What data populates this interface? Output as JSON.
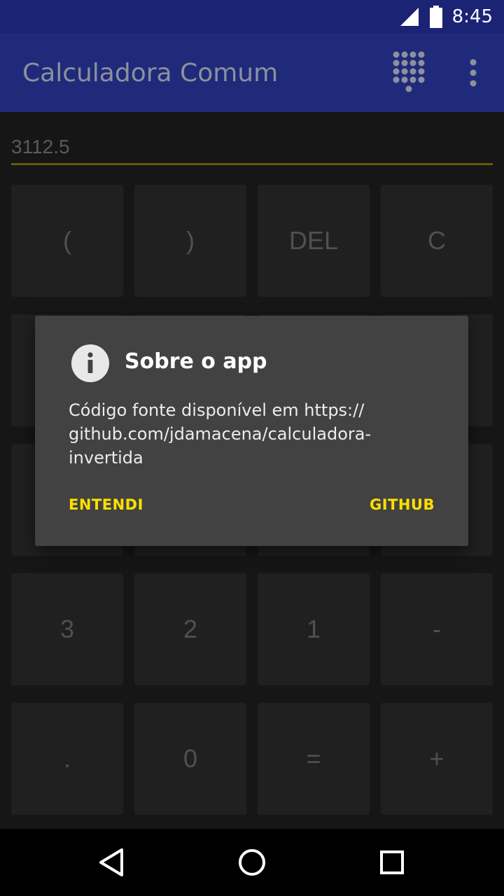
{
  "status_bar": {
    "time": "8:45",
    "icons": [
      "signal-icon",
      "battery-icon"
    ]
  },
  "app_bar": {
    "title": "Calculadora Comum",
    "actions": [
      "dialpad-icon",
      "overflow-menu-icon"
    ]
  },
  "display": {
    "value": "3112.5"
  },
  "keypad": {
    "visible_keys": [
      "(",
      ")",
      "DEL",
      "C",
      "3",
      "2",
      "1",
      "-",
      ".",
      "0",
      "=",
      "+"
    ]
  },
  "dialog": {
    "icon": "info-icon",
    "title": "Sobre o app",
    "message": "Código fonte disponível em https:// github.com/jdamacena/calculadora-invertida",
    "buttons": {
      "negative": "ENTENDI",
      "positive": "GITHUB"
    }
  },
  "navigation_bar": {
    "buttons": [
      "back-icon",
      "home-icon",
      "recents-icon"
    ]
  },
  "colors": {
    "status_bar": "#1b2375",
    "app_bar": "#1f2a7a",
    "background": "#1a1a1a",
    "key": "#262626",
    "dialog": "#424242",
    "accent": "#ffe000"
  }
}
